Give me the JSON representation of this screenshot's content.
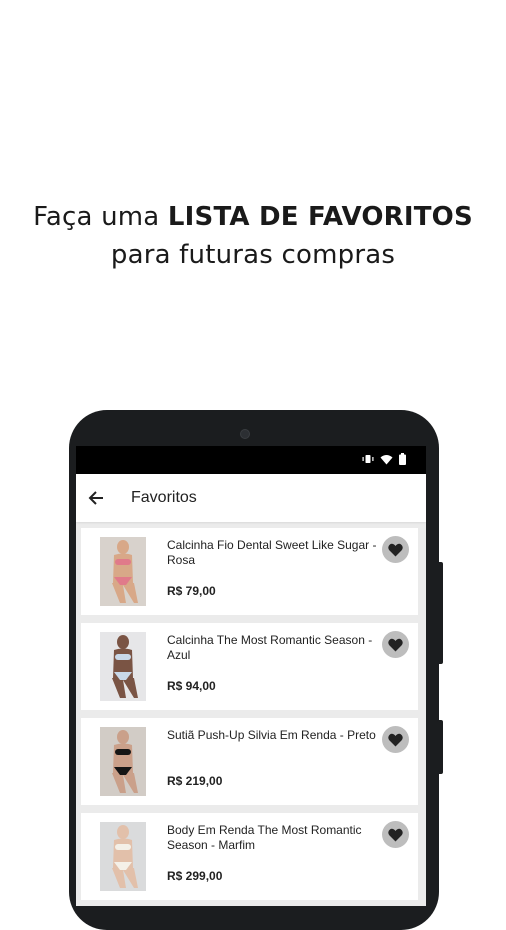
{
  "headline": {
    "line1_pre": "Faça uma ",
    "line1_bold": "LISTA DE FAVORITOS",
    "line2": "para futuras compras"
  },
  "appbar": {
    "title": "Favoritos",
    "back_icon": "arrow-left-icon"
  },
  "status_icons": [
    "vibrate-icon",
    "wifi-icon",
    "battery-icon"
  ],
  "products": [
    {
      "name": "Calcinha Fio Dental Sweet Like Sugar - Rosa",
      "price": "R$ 79,00",
      "thumb_color": "#e07a8a",
      "skin": "#d8a888",
      "bg": "#d8d2cc"
    },
    {
      "name": "Calcinha The Most Romantic Season - Azul",
      "price": "R$ 94,00",
      "thumb_color": "#c9d8e8",
      "skin": "#7a5444",
      "bg": "#e6e6e8"
    },
    {
      "name": "Sutiã Push-Up Silvia Em Renda - Preto",
      "price": "R$ 219,00",
      "thumb_color": "#151515",
      "skin": "#caa08a",
      "bg": "#d2ccc6"
    },
    {
      "name": "Body Em Renda The Most Romantic Season - Marfim",
      "price": "R$ 299,00",
      "thumb_color": "#f4f0e8",
      "skin": "#e2c0aa",
      "bg": "#dadbdc"
    }
  ],
  "favorite_icon": "heart-icon"
}
